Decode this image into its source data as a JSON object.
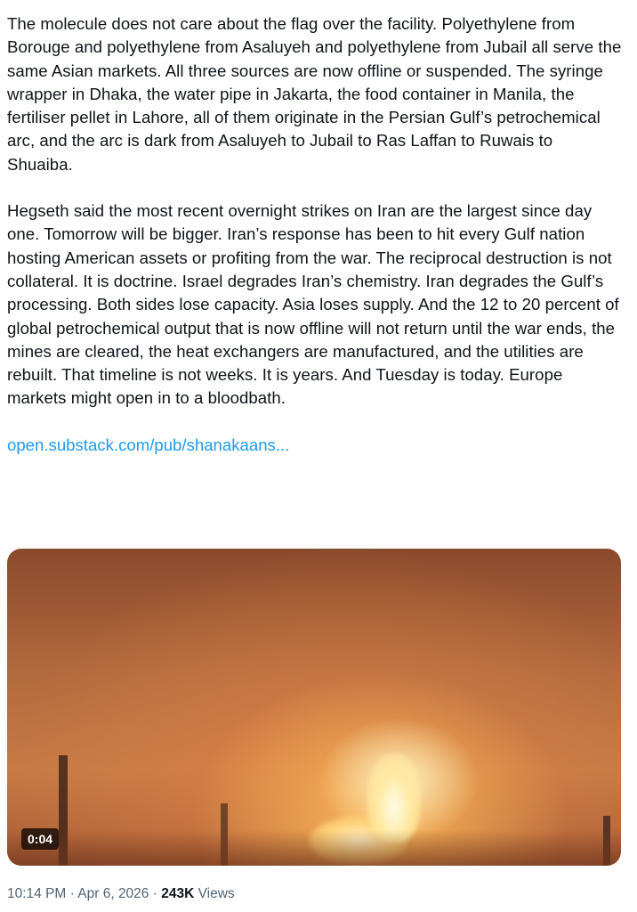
{
  "tweet": {
    "paragraphs": [
      "The molecule does not care about the flag over the facility. Polyethylene from Borouge and polyethylene from Asaluyeh and polyethylene from Jubail all serve the same Asian markets. All three sources are now offline or suspended. The syringe wrapper in Dhaka, the water pipe in Jakarta, the food container in Manila, the fertiliser pellet in Lahore, all of them originate in the Persian Gulf’s petrochemical arc, and the arc is dark from Asaluyeh to Jubail to Ras Laffan to Ruwais to Shuaiba.",
      "Hegseth said the most recent overnight strikes on Iran are the largest since day one. Tomorrow will be bigger. Iran’s response has been to hit every Gulf nation hosting American assets or profiting from the war. The reciprocal destruction is not collateral. It is doctrine. Israel degrades Iran’s chemistry. Iran degrades the Gulf’s processing. Both sides lose capacity. Asia loses supply. And the 12 to 20 percent of global petrochemical output that is now offline will not return until the war ends, the mines are cleared, the heat exchangers are manufactured, and the utilities are rebuilt. That timeline is not weeks. It is years. And Tuesday is today. Europe markets might open in to a bloodbath."
    ],
    "link": "open.substack.com/pub/shanakaans...",
    "video": {
      "duration": "0:04"
    },
    "meta": {
      "time": "10:14 PM",
      "separator1": " · ",
      "date": "Apr 6, 2026",
      "separator2": " · ",
      "views_count": "243K",
      "views_label": " Views"
    }
  }
}
